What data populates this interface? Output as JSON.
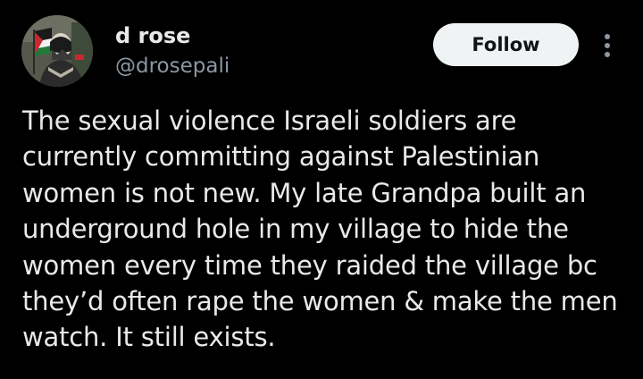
{
  "author": {
    "display_name": "d rose",
    "handle": "@drosepali",
    "avatar_icon": "profile-photo-with-palestinian-flag"
  },
  "actions": {
    "follow_label": "Follow",
    "more_icon": "more-vertical-icon"
  },
  "post": {
    "text": "The sexual violence Israeli soldiers are\ncurrently committing against Palestinian\nwomen is not new. My late Grandpa built an\nunderground hole in my village to hide the\nwomen every time they raided the village bc\nthey’d often rape the women & make the men\nwatch. It still exists."
  },
  "colors": {
    "background": "#000000",
    "primary_text": "#e7e9ea",
    "secondary_text": "#8b98a5",
    "follow_bg": "#eff3f4",
    "follow_text": "#0f1419"
  }
}
